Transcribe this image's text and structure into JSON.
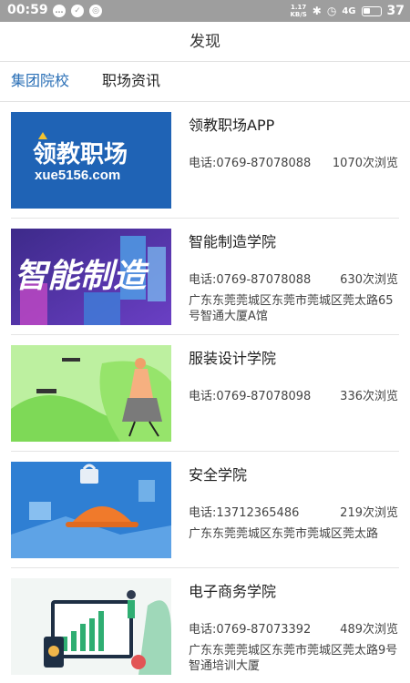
{
  "status_bar": {
    "time": "00:59",
    "speed_top": "1.17",
    "speed_bottom": "KB/S",
    "battery": "37",
    "signal": "4G"
  },
  "header": {
    "title": "发现"
  },
  "tabs": [
    {
      "label": "集团院校",
      "active": true
    },
    {
      "label": "职场资讯",
      "active": false
    }
  ],
  "colors": {
    "accent": "#2a6fb6",
    "status_bar": "#9e9e9e"
  },
  "items": [
    {
      "title": "领教职场APP",
      "phone": "电话:0769-87078088",
      "views": "1070次浏览",
      "address": "",
      "image": {
        "logo_text": "领教职场",
        "logo_url_text": "xue5156.com"
      }
    },
    {
      "title": "智能制造学院",
      "phone": "电话:0769-87078088",
      "views": "630次浏览",
      "address": "广东东莞莞城区东莞市莞城区莞太路65号智通大厦A馆",
      "image": {
        "banner_text": "智能制造"
      }
    },
    {
      "title": "服装设计学院",
      "phone": "电话:0769-87078098",
      "views": "336次浏览",
      "address": ""
    },
    {
      "title": "安全学院",
      "phone": "电话:13712365486",
      "views": "219次浏览",
      "address": "广东东莞莞城区东莞市莞城区莞太路"
    },
    {
      "title": "电子商务学院",
      "phone": "电话:0769-87073392",
      "views": "489次浏览",
      "address": "广东东莞莞城区东莞市莞城区莞太路9号智通培训大厦"
    }
  ]
}
